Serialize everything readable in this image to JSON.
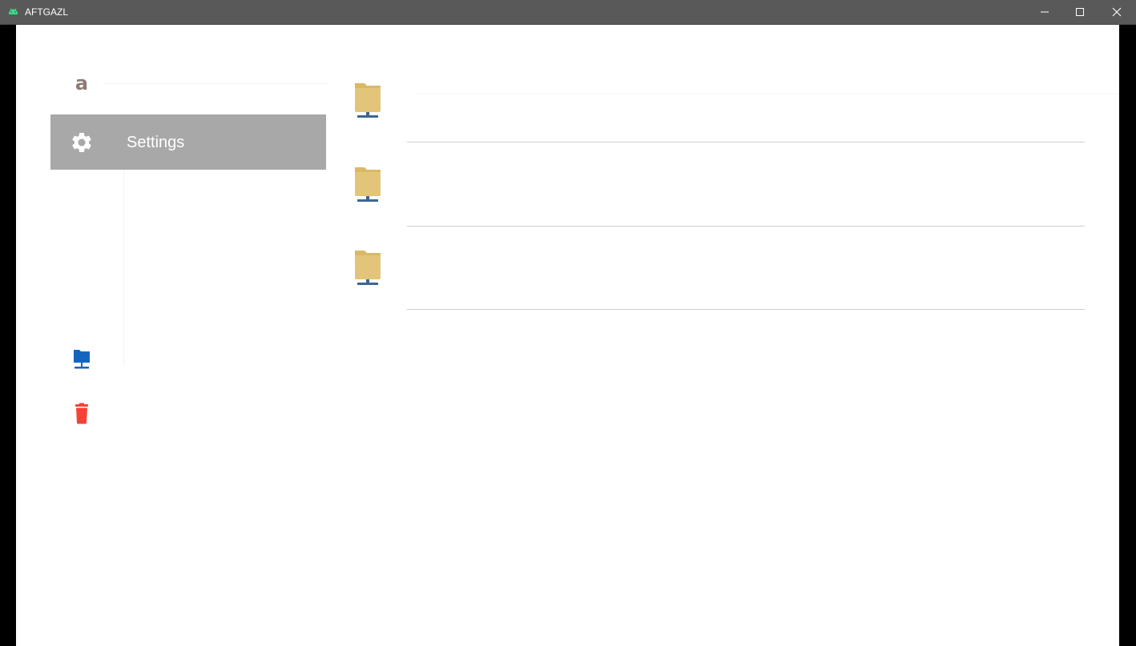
{
  "window": {
    "title": "AFTGAZL",
    "controls": {
      "minimize_icon": "minimize-icon",
      "maximize_icon": "maximize-icon",
      "close_icon": "close-icon"
    }
  },
  "sidebar": {
    "avatar_letter": "a",
    "avatar_color": "#8d7b72",
    "settings": {
      "label": "Settings",
      "icon": "gear-icon",
      "background": "#a8a8a8"
    },
    "network_folder_icon": "network-folder-icon",
    "network_folder_color": "#1565c0",
    "trash_icon": "trash-icon",
    "trash_color": "#f44336"
  },
  "folders": [
    {
      "name": "",
      "icon": "network-folder-icon"
    },
    {
      "name": "",
      "icon": "network-folder-icon"
    },
    {
      "name": "",
      "icon": "network-folder-icon"
    }
  ],
  "colors": {
    "titlebar": "#595959",
    "folder": "#e0c173",
    "network_base": "#3f6594"
  }
}
